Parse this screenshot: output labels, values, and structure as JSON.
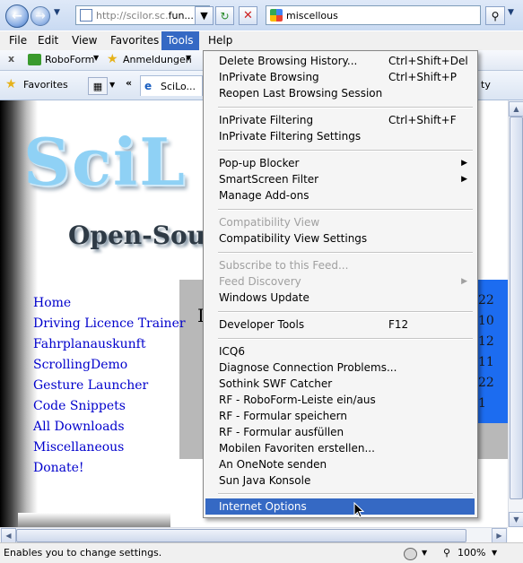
{
  "browser": {
    "url_prefix": "http://scilor.sc.",
    "url_main": "fun...",
    "search_value": "miscellous"
  },
  "menubar": [
    "File",
    "Edit",
    "View",
    "Favorites",
    "Tools",
    "Help"
  ],
  "toolbar": {
    "close": "x",
    "roboform": "RoboForm",
    "anmeldungen": "Anmeldungen"
  },
  "favbar": {
    "favorites": "Favorites",
    "tab_title": "SciLo...",
    "right_label": "ty"
  },
  "page": {
    "logo": "SciL",
    "subtitle": "Open-Sour",
    "links": [
      "Home",
      "Driving Licence Trainer",
      "Fahrplanauskunft",
      "ScrollingDemo",
      "Gesture Launcher",
      "Code Snippets",
      "All Downloads",
      "Miscellaneous",
      "Donate!"
    ],
    "numbers": [
      "22",
      "10",
      "12",
      "11",
      "22",
      "1"
    ],
    "box_letter": "I"
  },
  "tools_menu": {
    "items": [
      {
        "label": "Delete Browsing History...",
        "shortcut": "Ctrl+Shift+Del"
      },
      {
        "label": "InPrivate Browsing",
        "shortcut": "Ctrl+Shift+P"
      },
      {
        "label": "Reopen Last Browsing Session",
        "shortcut": ""
      },
      {
        "label": "InPrivate Filtering",
        "shortcut": "Ctrl+Shift+F"
      },
      {
        "label": "InPrivate Filtering Settings",
        "shortcut": ""
      },
      {
        "label": "Pop-up Blocker",
        "shortcut": ""
      },
      {
        "label": "SmartScreen Filter",
        "shortcut": ""
      },
      {
        "label": "Manage Add-ons",
        "shortcut": ""
      },
      {
        "label": "Compatibility View",
        "shortcut": ""
      },
      {
        "label": "Compatibility View Settings",
        "shortcut": ""
      },
      {
        "label": "Subscribe to this Feed...",
        "shortcut": ""
      },
      {
        "label": "Feed Discovery",
        "shortcut": ""
      },
      {
        "label": "Windows Update",
        "shortcut": ""
      },
      {
        "label": "Developer Tools",
        "shortcut": "F12"
      },
      {
        "label": "ICQ6",
        "shortcut": ""
      },
      {
        "label": "Diagnose Connection Problems...",
        "shortcut": ""
      },
      {
        "label": "Sothink SWF Catcher",
        "shortcut": ""
      },
      {
        "label": "RF - RoboForm-Leiste ein/aus",
        "shortcut": ""
      },
      {
        "label": "RF - Formular speichern",
        "shortcut": ""
      },
      {
        "label": "RF - Formular ausfüllen",
        "shortcut": ""
      },
      {
        "label": "Mobilen Favoriten erstellen...",
        "shortcut": ""
      },
      {
        "label": "An OneNote senden",
        "shortcut": ""
      },
      {
        "label": "Sun Java Konsole",
        "shortcut": ""
      },
      {
        "label": "Internet Options",
        "shortcut": ""
      }
    ]
  },
  "status": {
    "text": "Enables you to change settings.",
    "zoom": "100%"
  },
  "colors": {
    "menu_highlight": "#3569c4",
    "link": "#0000cc",
    "blue_column": "#1c6cf0"
  }
}
